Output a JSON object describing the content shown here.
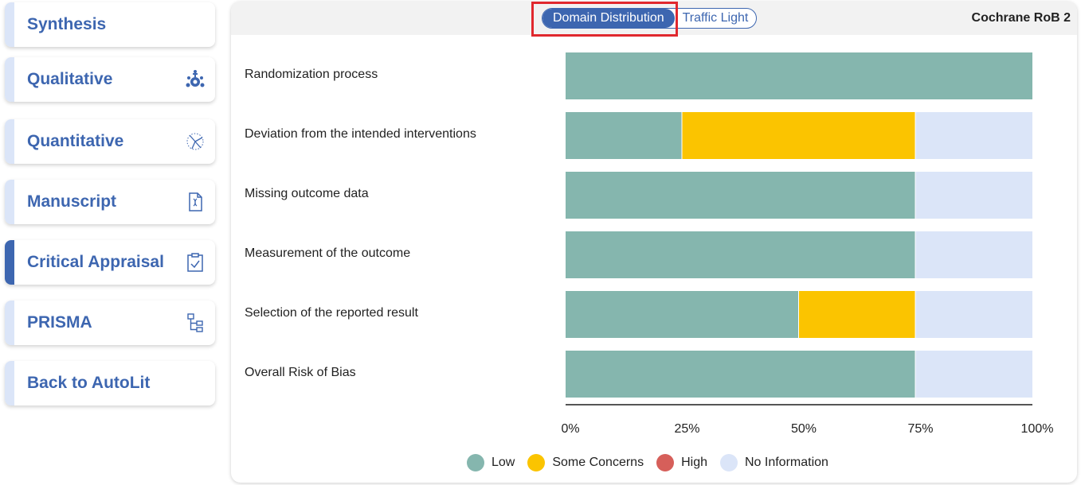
{
  "sidebar": {
    "items": [
      {
        "label": "Synthesis",
        "icon": "none",
        "active": false
      },
      {
        "label": "Qualitative",
        "icon": "qualitative-network-icon",
        "active": false
      },
      {
        "label": "Quantitative",
        "icon": "quantitative-scatter-icon",
        "active": false
      },
      {
        "label": "Manuscript",
        "icon": "manuscript-document-icon",
        "active": false
      },
      {
        "label": "Critical Appraisal",
        "icon": "clipboard-check-icon",
        "active": true
      },
      {
        "label": "PRISMA",
        "icon": "flowchart-icon",
        "active": false
      },
      {
        "label": "Back to AutoLit",
        "icon": "none",
        "active": false
      }
    ]
  },
  "panel": {
    "view_toggle": {
      "options": [
        "Domain Distribution",
        "Traffic Light"
      ],
      "selected": "Domain Distribution"
    },
    "instrument_title": "Cochrane RoB 2"
  },
  "colors": {
    "accent": "#3d66b0",
    "low": "#85b6ae",
    "some_concerns": "#fbc400",
    "high": "#d65f5a",
    "no_information": "#dbe5f8",
    "highlight": "#e0282e"
  },
  "chart_data": {
    "type": "bar",
    "orientation": "horizontal-stacked",
    "x_unit": "percent",
    "xlim": [
      0,
      100
    ],
    "x_ticks": [
      "0%",
      "25%",
      "50%",
      "75%",
      "100%"
    ],
    "categories": [
      "Randomization process",
      "Deviation from the intended interventions",
      "Missing outcome data",
      "Measurement of the outcome",
      "Selection of the reported result",
      "Overall Risk of Bias"
    ],
    "series": [
      {
        "name": "Low",
        "values": [
          100,
          25,
          75,
          75,
          50,
          75
        ]
      },
      {
        "name": "Some Concerns",
        "values": [
          0,
          50,
          0,
          0,
          25,
          0
        ]
      },
      {
        "name": "High",
        "values": [
          0,
          0,
          0,
          0,
          0,
          0
        ]
      },
      {
        "name": "No Information",
        "values": [
          0,
          25,
          25,
          25,
          25,
          25
        ]
      }
    ],
    "legend_position": "bottom"
  }
}
